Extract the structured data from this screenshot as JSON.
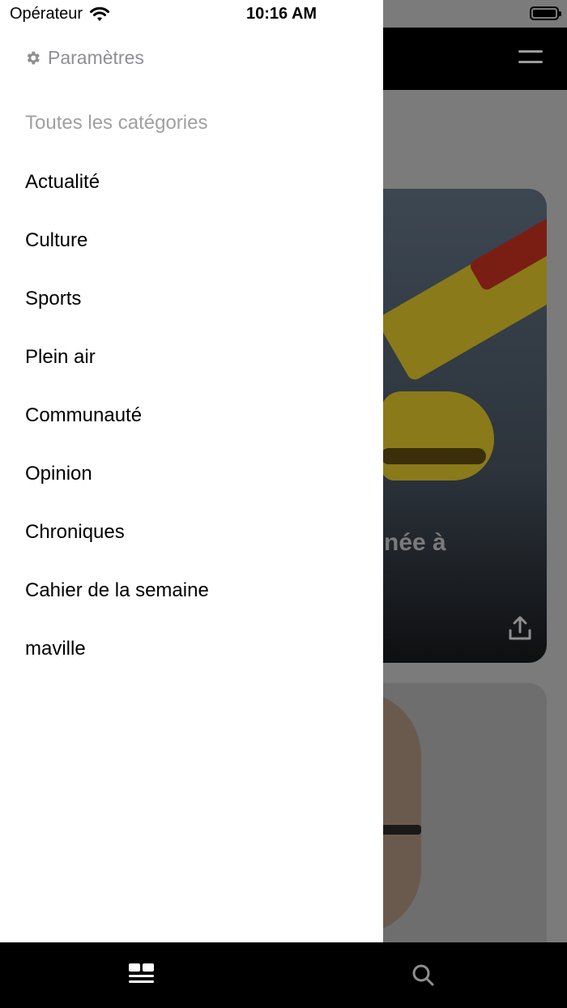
{
  "status_bar": {
    "carrier": "Opérateur",
    "time": "10:16 AM"
  },
  "drawer": {
    "settings_label": "Paramètres",
    "section_title": "Toutes les catégories",
    "categories": [
      "Actualité",
      "Culture",
      "Sports",
      "Plein air",
      "Communauté",
      "Opinion",
      "Chroniques",
      "Cahier de la semaine",
      "maville"
    ]
  },
  "background": {
    "card_partial_title": "née à"
  },
  "icons": {
    "wifi": "wifi-icon",
    "battery": "battery-icon",
    "settings": "gear-icon",
    "menu": "hamburger-menu-icon",
    "share": "share-icon",
    "feed_tab": "feed-icon",
    "search_tab": "search-icon"
  }
}
